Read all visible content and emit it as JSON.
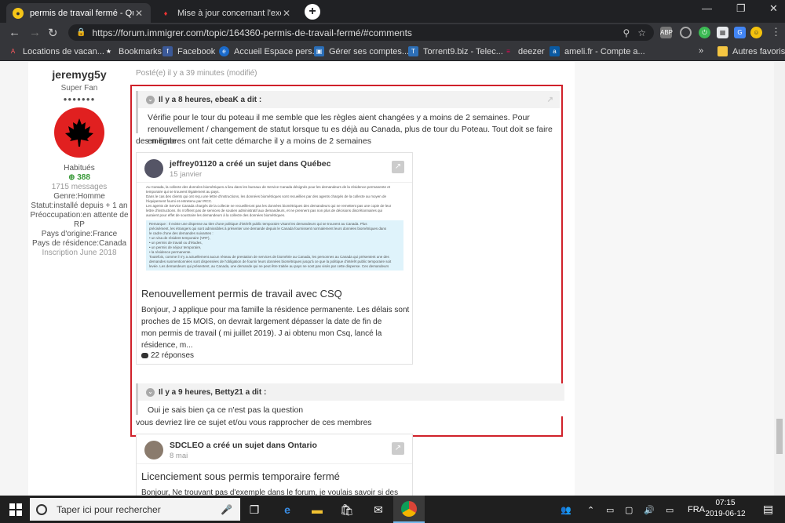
{
  "browser": {
    "tabs": [
      {
        "title": "permis de travail fermé - Québec",
        "active": true
      },
      {
        "title": "Mise à jour concernant l'exécution",
        "active": false
      }
    ],
    "url": "https://forum.immigrer.com/topic/164360-permis-de-travail-fermé/#comments",
    "bookmarks": [
      {
        "label": "Locations de vacan...",
        "icon": "airbnb-icon"
      },
      {
        "label": "Bookmarks",
        "icon": "star-icon"
      },
      {
        "label": "Facebook",
        "icon": "facebook-icon"
      },
      {
        "label": "Accueil Espace pers...",
        "icon": "espace-icon"
      },
      {
        "label": "Gérer ses comptes...",
        "icon": "bank-icon"
      },
      {
        "label": "Torrent9.biz - Telec...",
        "icon": "torrent-icon"
      },
      {
        "label": "deezer",
        "icon": "deezer-icon"
      },
      {
        "label": "ameli.fr - Compte a...",
        "icon": "ameli-icon"
      }
    ],
    "bookmarks_more": "»",
    "other_bookmarks": "Autres favoris"
  },
  "author": {
    "name": "jeremyg5y",
    "rank": "Super Fan",
    "pips": "●●●●●●●",
    "location": "Habitués",
    "reputation": "388",
    "messages": "1715 messages",
    "genre": "Genre:Homme",
    "statut": "Statut:installé depuis + 1 an",
    "preoccupation_1": "Préoccupation:en attente de",
    "preoccupation_2": "RP",
    "pays_origine": "Pays d'origine:France",
    "pays_residence": "Pays de résidence:Canada",
    "inscription": "Inscription June 2018"
  },
  "post": {
    "date": "Posté(e) il y a 39 minutes (modifié)",
    "quote1": {
      "head": "Il y a 8 heures, ebeaK a dit :",
      "body": "Vérifie pour le tour du poteau il me semble que les règles aient changées y a moins de 2 semaines. Pour renouvellement / changement de statut lorsque tu es déjà au Canada, plus de tour du Poteau. Tout doit se faire en ligne"
    },
    "text1": "des membres ont fait cette démarche il y a moins de 2 semaines",
    "card1": {
      "author_line": "jeffrey01120 a créé un sujet dans Québec",
      "date": "15 janvier",
      "title": "Renouvellement permis de travail avec CSQ",
      "excerpt_1": "Bonjour, J applique pour ma famille la résidence permanente. Les délais sont",
      "excerpt_2": "proches de 15 MOIS, on devrait largement dépasser la date de fin de",
      "excerpt_3": "mon permis de travail ( mi juillet 2019). J ai obtenu mon Csq, lancé la résidence, m...",
      "replies": "22 réponses",
      "doc_lines": [
        "Au Canada, la collecte des données biométriques a lieu dans les bureaux de Service Canada désignés pour les demandeurs de la résidence permanente et",
        "temporaire qui se trouvent légalement au pays.",
        "Dans le cas des clients qui ont reçu une lettre d'instructions, les données biométriques sont recueillies par des agents chargés de la collecte au moyen de",
        "l'équipement fourni et entretenu par IRCC.",
        "Les agents de Service Canada chargés de la collecte ne recueilleront pas les données biométriques des demandeurs qui ne remettent pas une copie de leur",
        "lettre d'instructions. Ils n'offrent pas de services de soutien administratif aux demandeurs, et ne prennent pas non plus de décisions discrétionnaires qui",
        "auraient pour effet de soustraire les demandeurs à la collecte des données biométriques."
      ],
      "doc_note_lines": [
        "Remarque : Il existe une dispense au titre d'une politique d'intérêt public temporaire visant les demandeurs qui se trouvent au Canada. Plus",
        "précisément, les étrangers qui sont admissibles à présenter une demande depuis le Canada fournissent normalement leurs données biométriques dans",
        "le cadre d'une des demandes suivantes :",
        "• un visa de résident temporaire (VRT),",
        "• un permis de travail ou d'études,",
        "• un permis de séjour temporaire,",
        "• la résidence permanente.",
        "Toutefois, comme il n'y a actuellement aucun réseau de prestation de services de biométrie au Canada, les personnes au Canada qui présentent une des",
        "demandes susmentionnées sont dispensées de l'obligation de fournir leurs données biométriques jusqu'à ce que la politique d'intérêt public temporaire soit",
        "levée. Les demandeurs qui présentent, au Canada, une demande qui ne peut être traitée au pays ne sont pas visés par cette dispense. Ces demandeurs"
      ]
    },
    "quote2": {
      "head": "Il y a 9 heures, Betty21 a dit :",
      "body": "Oui je sais bien ça ce n'est pas la question"
    },
    "text2": "vous devriez lire ce sujet et/ou vous rapprocher de ces membres",
    "card2": {
      "author_line": "SDCLEO a créé un sujet dans Ontario",
      "date": "8 mai",
      "title": "Licenciement sous permis temporaire fermé",
      "excerpt_1": "Bonjour, Ne trouvant pas d'exemple dans le forum, je voulais savoir si des personnes"
    }
  },
  "taskbar": {
    "search_placeholder": "Taper ici pour rechercher",
    "language": "FRA",
    "time": "07:15",
    "date": "2019-06-12"
  },
  "colors": {
    "highlight_border": "#d0212a",
    "chrome_dark": "#202124",
    "chrome_mid": "#35363a"
  }
}
